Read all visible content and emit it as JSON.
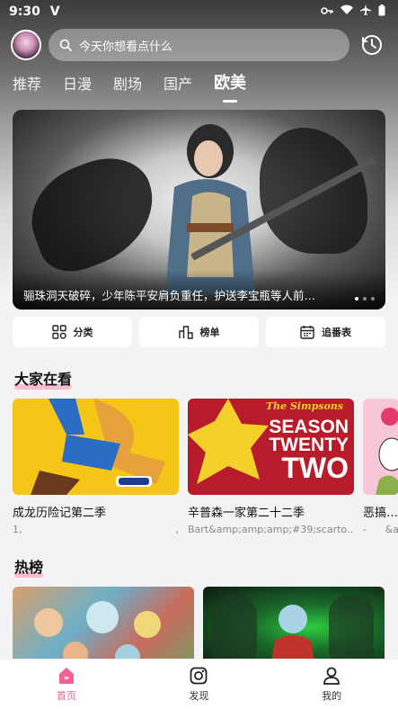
{
  "status": {
    "time": "9:30",
    "carrier": "V"
  },
  "search": {
    "placeholder": "今天你想看点什么"
  },
  "tabs": [
    {
      "label": "推荐"
    },
    {
      "label": "日漫"
    },
    {
      "label": "剧场"
    },
    {
      "label": "国产"
    },
    {
      "label": "欧美"
    }
  ],
  "banner": {
    "caption": "骊珠洞天破碎，少年陈平安肩负重任，护送李宝瓶等人前…",
    "page_count": 3,
    "active_page": 1
  },
  "quick": {
    "category": "分类",
    "ranking": "榜单",
    "schedule": "追番表"
  },
  "sections": {
    "watching": "大家在看",
    "hot": "热榜"
  },
  "watching": [
    {
      "title": "成龙历险记第二季",
      "sub_left": "1,",
      "sub_right": ","
    },
    {
      "title": "辛普森一家第二十二季",
      "sub_left": "Bart&amp;amp;amp;#39;scarto…",
      "sub_right": "",
      "poster_text": [
        "SEASON",
        "TWENTY",
        "TWO"
      ],
      "poster_logo": "The Simpsons"
    },
    {
      "title": "恶搞之家",
      "sub_left": "-",
      "sub_right": "&a"
    }
  ],
  "nav": {
    "home": "首页",
    "discover": "发现",
    "mine": "我的"
  },
  "colors": {
    "accent": "#f06292"
  }
}
